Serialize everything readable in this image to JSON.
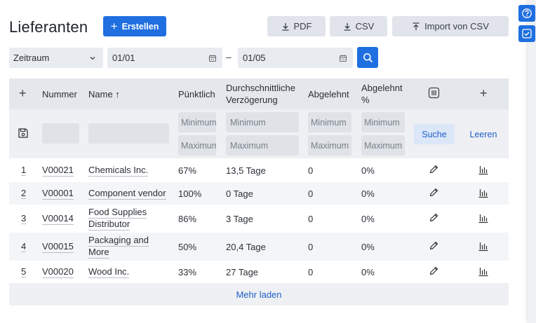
{
  "header": {
    "title": "Lieferanten",
    "create_label": "Erstellen",
    "pdf_label": "PDF",
    "csv_label": "CSV",
    "import_label": "Import von CSV"
  },
  "filters": {
    "period_label": "Zeitraum",
    "date_from": "01/01",
    "date_to": "01/05",
    "date_separator": "–"
  },
  "table": {
    "columns": {
      "number": "Nummer",
      "name": "Name ↑",
      "punctual": "Pünktlich",
      "avg_delay_line1": "Durchschnittliche",
      "avg_delay_line2": "Verzögerung",
      "rejected": "Abgelehnt",
      "rejected_pct_line1": "Abgelehnt",
      "rejected_pct_line2": "%"
    },
    "filter_placeholders": {
      "min": "Minimum",
      "max": "Maximum"
    },
    "search_label": "Suche",
    "clear_label": "Leeren",
    "rows": [
      {
        "idx": "1",
        "number": "V00021",
        "name1": "Chemicals Inc.",
        "name2": "",
        "punctual": "67%",
        "delay": "13,5 Tage",
        "rejected": "0",
        "rejected_pct": "0%"
      },
      {
        "idx": "2",
        "number": "V00001",
        "name1": "Component vendor",
        "name2": "",
        "punctual": "100%",
        "delay": "0 Tage",
        "rejected": "0",
        "rejected_pct": "0%"
      },
      {
        "idx": "3",
        "number": "V00014",
        "name1": "Food Supplies",
        "name2": "Distributor",
        "punctual": "86%",
        "delay": "3 Tage",
        "rejected": "0",
        "rejected_pct": "0%"
      },
      {
        "idx": "4",
        "number": "V00015",
        "name1": "Packaging and",
        "name2": "More",
        "punctual": "50%",
        "delay": "20,4 Tage",
        "rejected": "0",
        "rejected_pct": "0%"
      },
      {
        "idx": "5",
        "number": "V00020",
        "name1": "Wood Inc.",
        "name2": "",
        "punctual": "33%",
        "delay": "27 Tage",
        "rejected": "0",
        "rejected_pct": "0%"
      }
    ],
    "load_more_label": "Mehr laden"
  },
  "colors": {
    "primary": "#1f6fe0",
    "link": "#1f5fc8",
    "header_bg": "#e4e7ec"
  }
}
